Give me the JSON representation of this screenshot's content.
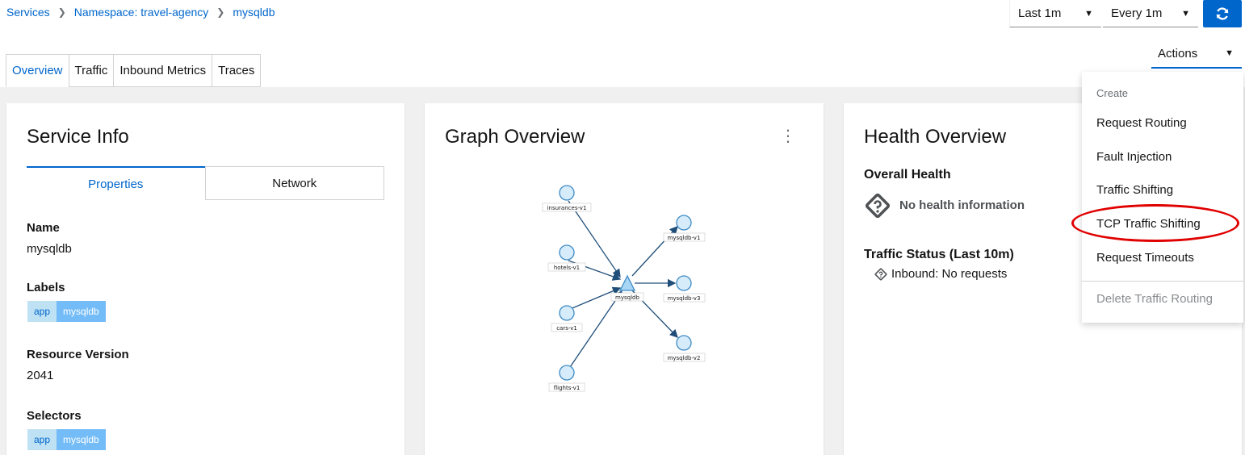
{
  "breadcrumb": {
    "items": [
      "Services",
      "Namespace: travel-agency",
      "mysqldb"
    ]
  },
  "toolbar": {
    "duration": "Last 1m",
    "refresh_interval": "Every 1m",
    "actions_label": "Actions",
    "primary_color": "#0066cc"
  },
  "tabs": [
    "Overview",
    "Traffic",
    "Inbound Metrics",
    "Traces"
  ],
  "service_info": {
    "title": "Service Info",
    "tabs": [
      "Properties",
      "Network"
    ],
    "name_label": "Name",
    "name_value": "mysqldb",
    "labels_label": "Labels",
    "labels": {
      "key": "app",
      "value": "mysqldb"
    },
    "resource_version_label": "Resource Version",
    "resource_version_value": "2041",
    "selectors_label": "Selectors",
    "selectors": {
      "key": "app",
      "value": "mysqldb"
    }
  },
  "graph": {
    "title": "Graph Overview",
    "nodes": {
      "insurances": "insurances-v1",
      "hotels": "hotels-v1",
      "cars": "cars-v1",
      "flights": "flights-v1",
      "center": "mysqldb",
      "v1": "mysqldb-v1",
      "v3": "mysqldb-v3",
      "v2": "mysqldb-v2"
    }
  },
  "health": {
    "title": "Health Overview",
    "overall_label": "Overall Health",
    "no_health": "No health information",
    "traffic_label": "Traffic Status (Last 10m)",
    "inbound": "Inbound: No requests"
  },
  "actions_menu": {
    "group": "Create",
    "items": [
      "Request Routing",
      "Fault Injection",
      "Traffic Shifting",
      "TCP Traffic Shifting",
      "Request Timeouts"
    ],
    "delete": "Delete Traffic Routing"
  }
}
